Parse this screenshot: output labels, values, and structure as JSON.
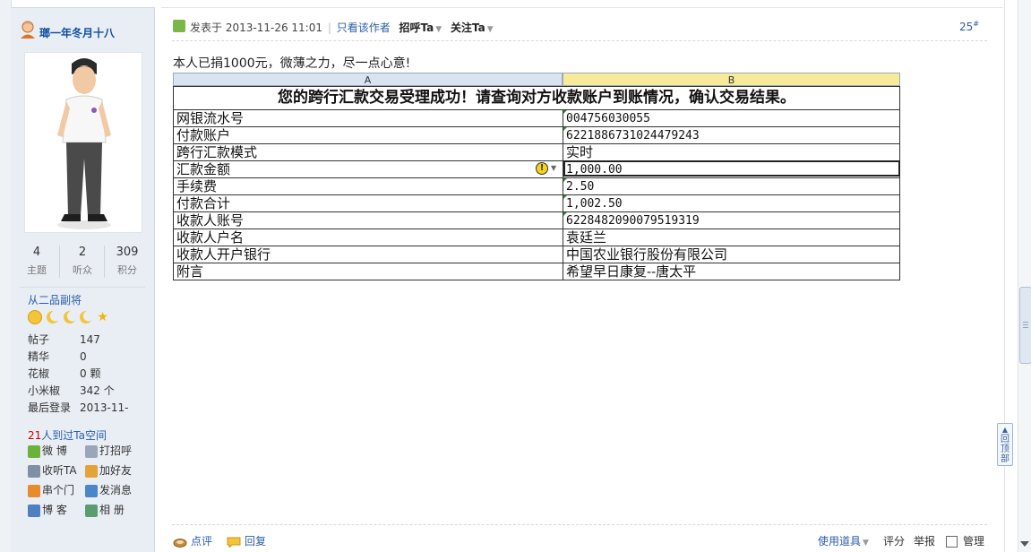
{
  "sidebar": {
    "username": "瑯一年冬月十八",
    "stats": [
      {
        "value": "4",
        "label": "主题"
      },
      {
        "value": "2",
        "label": "听众"
      },
      {
        "value": "309",
        "label": "积分"
      }
    ],
    "rank": "从二品副将",
    "info": [
      {
        "key": "帖子",
        "value": "147"
      },
      {
        "key": "精华",
        "value": "0"
      },
      {
        "key": "花椒",
        "value": "0 颗"
      },
      {
        "key": "小米椒",
        "value": "342 个"
      },
      {
        "key": "最后登录",
        "value": "2013-11-"
      }
    ],
    "visitors_count": "21",
    "visitors_text": "人到过Ta空间",
    "actions": {
      "weibo": "微 博",
      "greet": "打招呼",
      "follow": "收听TA",
      "add_friend": "加好友",
      "visit": "串个门",
      "message": "发消息",
      "blog": "博 客",
      "album": "相 册"
    }
  },
  "post": {
    "posted_prefix": "发表于",
    "posted_time": "2013-11-26 11:01",
    "only_author": "只看该作者",
    "greet_ta": "招呼Ta",
    "follow_ta": "关注Ta",
    "floor": "25",
    "floor_mark": "#",
    "text": "本人已捐1000元，微薄之力，尽一点心意!"
  },
  "sheet": {
    "col_a": "A",
    "col_b": "B",
    "banner": "您的跨行汇款交易受理成功！请查询对方收款账户到账情况，确认交易结果。",
    "warning_glyph": "!",
    "rows": [
      {
        "key": "网银流水号",
        "value": "004756030055"
      },
      {
        "key": "付款账户",
        "value": "6221886731024479243"
      },
      {
        "key": "跨行汇款模式",
        "value": "实时"
      },
      {
        "key": "汇款金额",
        "value": "1,000.00"
      },
      {
        "key": "手续费",
        "value": "2.50"
      },
      {
        "key": "付款合计",
        "value": "1,002.50"
      },
      {
        "key": "收款人账号",
        "value": "6228482090079519319"
      },
      {
        "key": "收款人户名",
        "value": "袁廷兰"
      },
      {
        "key": "收款人开户银行",
        "value": "中国农业银行股份有限公司"
      },
      {
        "key": "附言",
        "value": "希望早日康复--唐太平"
      }
    ]
  },
  "footer": {
    "comment": "点评",
    "reply": "回复",
    "use_tool": "使用道具",
    "rate": "评分",
    "report": "举报",
    "manage": "管理"
  },
  "back_top": "回顶部"
}
